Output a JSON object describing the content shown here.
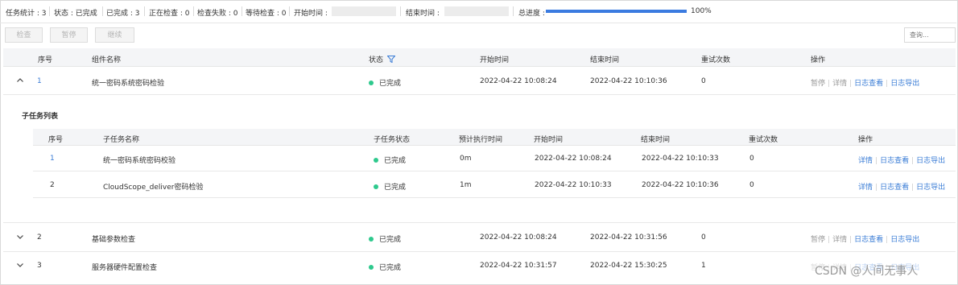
{
  "stats": {
    "total": "任务统计 : 3",
    "status": "状态 : 已完成",
    "completed": "已完成 : 3",
    "checking": "正在检查 : 0",
    "failed": "检查失败 : 0",
    "waiting": "等待检查 : 0",
    "start_time_label": "开始时间 :",
    "end_time_label": "结束时间 :",
    "progress_label": "总进度 :",
    "progress_text": "100%",
    "progress_value": 100
  },
  "toolbar": {
    "check": "检查",
    "pause": "暂停",
    "resume": "继续",
    "search_placeholder": "查询..."
  },
  "table": {
    "columns": [
      "序号",
      "组件名称",
      "状态",
      "开始时间",
      "结束时间",
      "重试次数",
      "操作"
    ],
    "rows": [
      {
        "index": "1",
        "name": "统一密码系统密码检验",
        "status": "已完成",
        "start": "2022-04-22 10:08:24",
        "end": "2022-04-22 10:10:36",
        "retries": "0",
        "ops": [
          "暂停",
          "详情",
          "日志查看",
          "日志导出"
        ]
      },
      {
        "index": "2",
        "name": "基础参数检查",
        "status": "已完成",
        "start": "2022-04-22 10:08:24",
        "end": "2022-04-22 10:31:56",
        "retries": "0",
        "ops": [
          "暂停",
          "详情",
          "日志查看",
          "日志导出"
        ]
      },
      {
        "index": "3",
        "name": "服务器硬件配置检查",
        "status": "已完成",
        "start": "2022-04-22 10:31:57",
        "end": "2022-04-22 15:30:25",
        "retries": "1",
        "ops": [
          "暂停",
          "详情",
          "日志查看",
          "日志导出"
        ]
      }
    ]
  },
  "subtask": {
    "title": "子任务列表",
    "columns": [
      "序号",
      "子任务名称",
      "子任务状态",
      "预计执行时间",
      "开始时间",
      "结束时间",
      "重试次数",
      "操作"
    ],
    "rows": [
      {
        "index": "1",
        "name": "统一密码系统密码校验",
        "status": "已完成",
        "eta": "0m",
        "start": "2022-04-22 10:08:24",
        "end": "2022-04-22 10:10:33",
        "retries": "0",
        "ops": [
          "详情",
          "日志查看",
          "日志导出"
        ]
      },
      {
        "index": "2",
        "name": "CloudScope_deliver密码检验",
        "status": "已完成",
        "eta": "1m",
        "start": "2022-04-22 10:10:33",
        "end": "2022-04-22 10:10:36",
        "retries": "0",
        "ops": [
          "详情",
          "日志查看",
          "日志导出"
        ]
      }
    ]
  },
  "watermark": "CSDN @人间无事人",
  "colors": {
    "accent": "#3b7be0",
    "success": "#2ec98d",
    "link": "#3a7cd6"
  }
}
